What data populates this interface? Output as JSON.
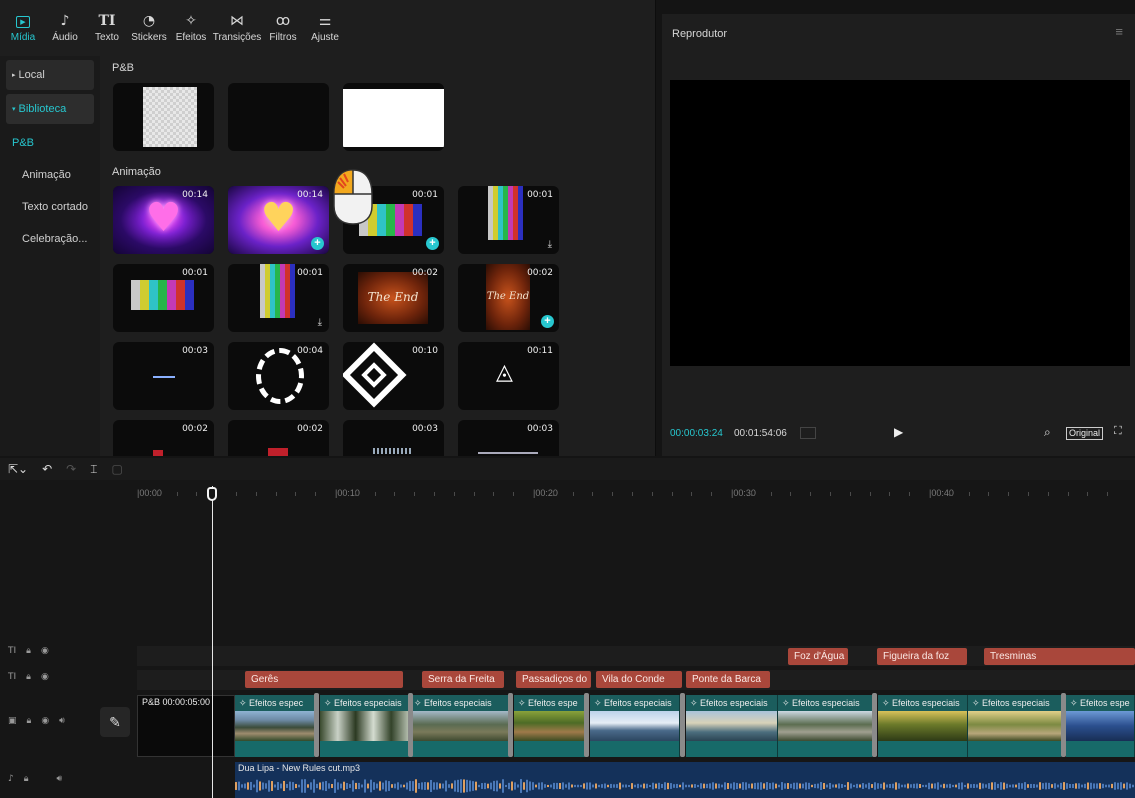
{
  "toolbar": {
    "tools": [
      {
        "label": "Mídia",
        "icon": "media-icon",
        "glyph": "▸"
      },
      {
        "label": "Áudio",
        "icon": "audio-icon",
        "glyph": "♪"
      },
      {
        "label": "Texto",
        "icon": "text-icon",
        "glyph": "TI"
      },
      {
        "label": "Stickers",
        "icon": "sticker-icon",
        "glyph": "◔"
      },
      {
        "label": "Efeitos",
        "icon": "effects-icon",
        "glyph": "✧"
      },
      {
        "label": "Transições",
        "icon": "transitions-icon",
        "glyph": "⋈"
      },
      {
        "label": "Filtros",
        "icon": "filters-icon",
        "glyph": "ꝏ"
      },
      {
        "label": "Ajuste",
        "icon": "adjust-icon",
        "glyph": "⚌"
      }
    ]
  },
  "sidebar": {
    "local": "Local",
    "library": "Biblioteca",
    "items": [
      "P&B",
      "Animação",
      "Texto cortado",
      "Celebração..."
    ]
  },
  "gallery": {
    "section_pb": "P&B",
    "section_anim": "Animação",
    "durations": {
      "a1": "00:14",
      "a2": "00:14",
      "a3": "00:01",
      "a4": "00:01",
      "b1": "00:01",
      "b2": "00:01",
      "b3": "00:02",
      "b4": "00:02",
      "c1": "00:03",
      "c2": "00:04",
      "c3": "00:10",
      "c4": "00:11",
      "d1": "00:02",
      "d2": "00:02",
      "d3": "00:03",
      "d4": "00:03"
    },
    "theend_text": "The End"
  },
  "player": {
    "title": "Reprodutor",
    "time_current": "00:00:03:24",
    "time_total": "00:01:54:06",
    "original_label": "Original"
  },
  "ruler": {
    "ticks": [
      "|00:00",
      "|00:10",
      "|00:20",
      "|00:30",
      "|00:40"
    ]
  },
  "timeline": {
    "text_track_top": [
      "Foz d'Água",
      "Figueira da foz",
      "Tresminas"
    ],
    "text_track_bottom": [
      "Gerês",
      "Serra da Freita",
      "Passadiços do",
      "Vila do Conde",
      "Ponte da Barca"
    ],
    "pb_clip": "P&B  00:00:05:00",
    "video_clip_label": "Efeitos especiais",
    "video_clip_label_short": "Efeitos espec",
    "video_clip_label_xs": "Efeitos espe",
    "audio_clip": "Dua Lipa - New Rules cut.mp3"
  },
  "colors": {
    "accent": "#27c7cf",
    "text_clip": "#a9473b",
    "video_track": "#14504f",
    "audio_track": "#14315a"
  }
}
